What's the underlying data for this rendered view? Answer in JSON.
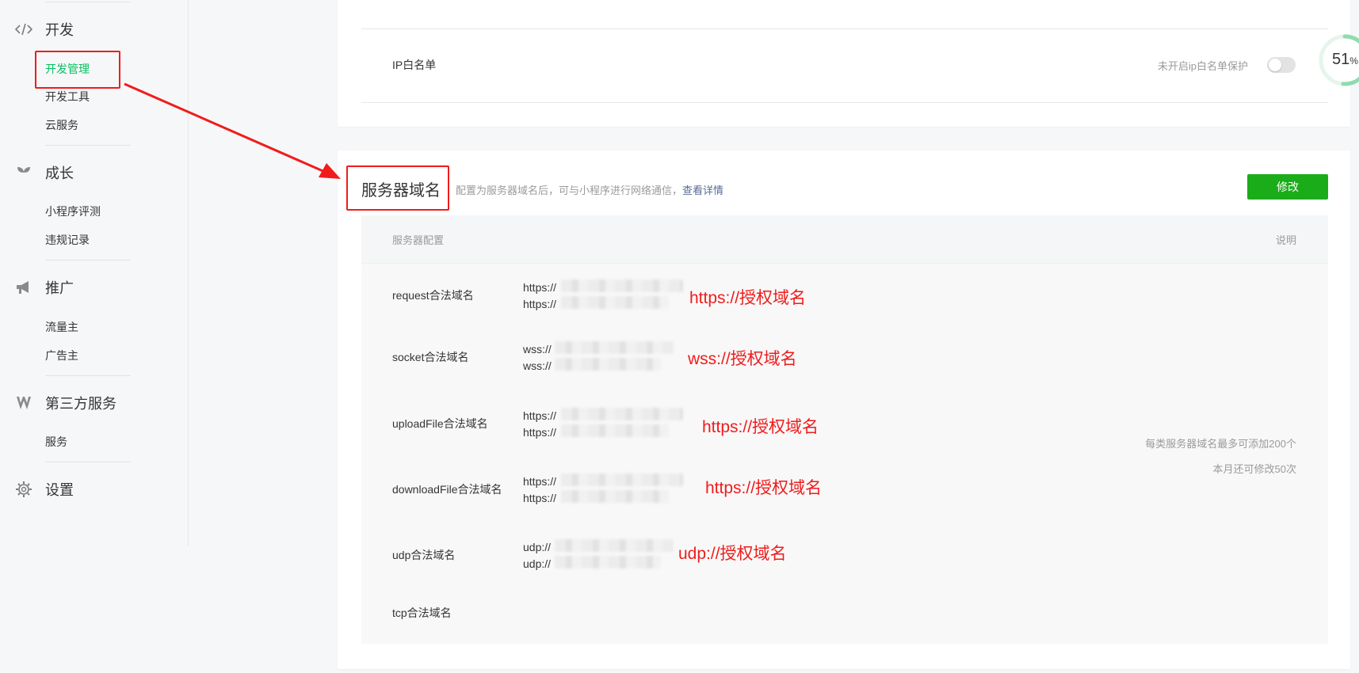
{
  "sidebar": {
    "groups": [
      {
        "label": "开发",
        "icon": "code-icon"
      },
      {
        "label": "成长",
        "icon": "sprout-icon"
      },
      {
        "label": "推广",
        "icon": "megaphone-icon"
      },
      {
        "label": "第三方服务",
        "icon": "third-party-icon"
      },
      {
        "label": "设置",
        "icon": "gear-icon"
      }
    ],
    "items": {
      "dev_manage": "开发管理",
      "dev_tools": "开发工具",
      "cloud": "云服务",
      "evaluation": "小程序评测",
      "violations": "违规记录",
      "traffic_owner": "流量主",
      "advertiser": "广告主",
      "service": "服务"
    },
    "active_item": "开发管理"
  },
  "ip_whitelist": {
    "label": "IP白名单",
    "status": "未开启ip白名单保护",
    "enabled": false
  },
  "progress": {
    "value": "51",
    "unit": "%",
    "fraction": 0.51
  },
  "server_domain": {
    "title": "服务器域名",
    "description": "配置为服务器域名后，可与小程序进行网络通信，",
    "details_link": "查看详情",
    "edit_button": "修改",
    "header_config": "服务器配置",
    "header_note": "说明",
    "rows": [
      {
        "name": "request合法域名",
        "urls": [
          "https://",
          "https://"
        ],
        "annotation": "https://授权域名"
      },
      {
        "name": "socket合法域名",
        "urls": [
          "wss://",
          "wss://"
        ],
        "annotation": "wss://授权域名"
      },
      {
        "name": "uploadFile合法域名",
        "urls": [
          "https://",
          "https://"
        ],
        "annotation": "https://授权域名"
      },
      {
        "name": "downloadFile合法域名",
        "urls": [
          "https://",
          "https://"
        ],
        "annotation": "https://授权域名"
      },
      {
        "name": "udp合法域名",
        "urls": [
          "udp://",
          "udp://"
        ],
        "annotation": "udp://授权域名"
      },
      {
        "name": "tcp合法域名",
        "urls": [],
        "annotation": ""
      }
    ],
    "notes": [
      "每类服务器域名最多可添加200个",
      "本月还可修改50次"
    ]
  },
  "colors": {
    "accent_green": "#07c160",
    "button_green": "#1aad19",
    "annotation_red": "#f01c1c",
    "link_blue": "#576b95"
  }
}
